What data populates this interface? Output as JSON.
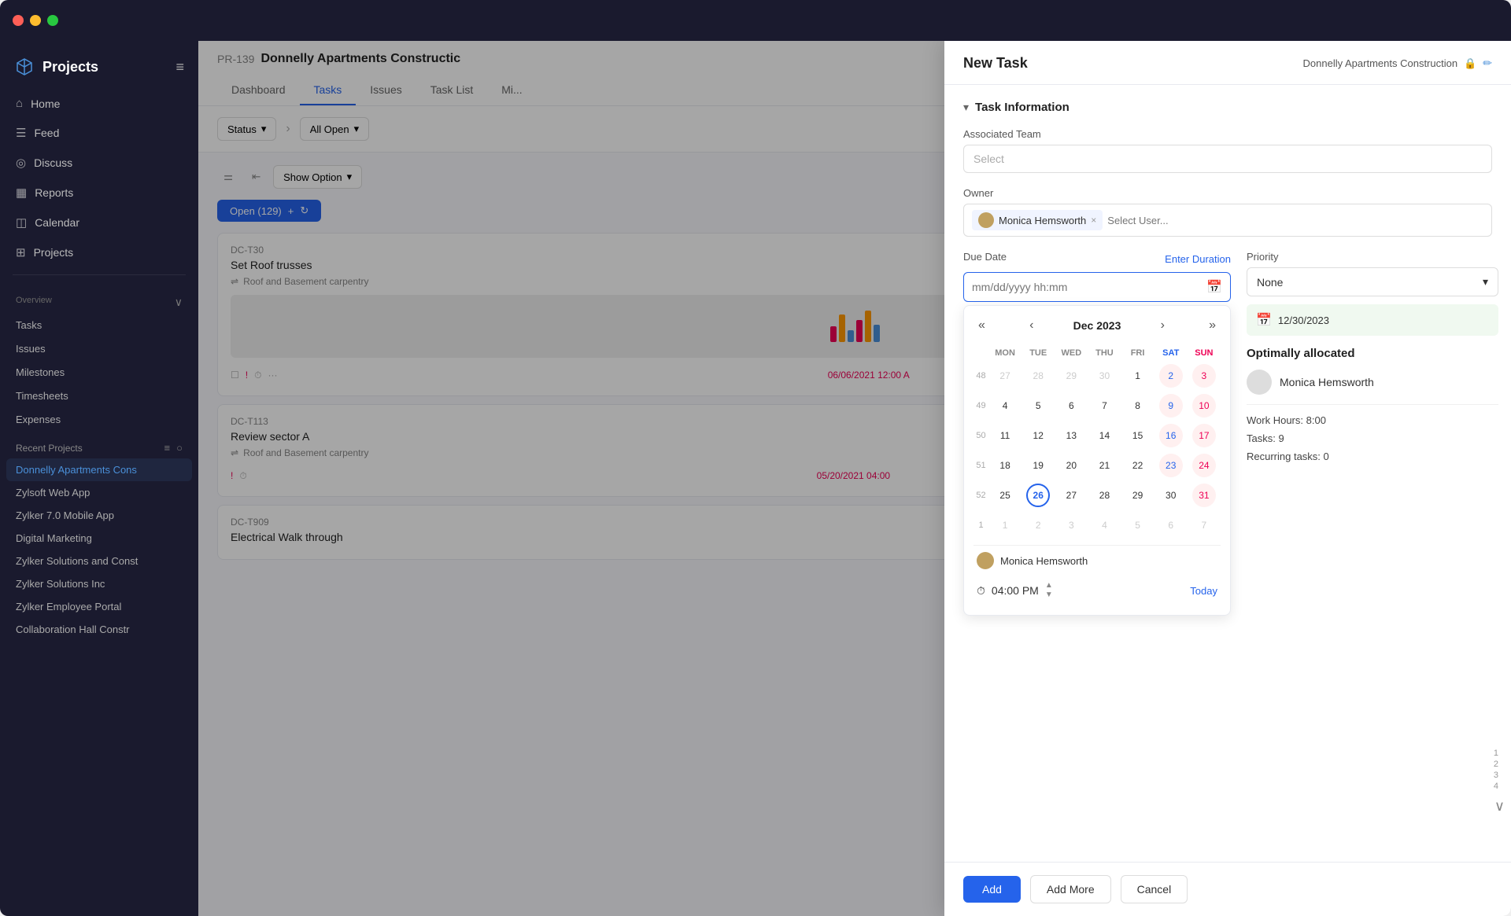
{
  "window": {
    "titlebar": {
      "dots": [
        "red",
        "yellow",
        "green"
      ]
    }
  },
  "sidebar": {
    "logo": "Projects",
    "nav_items": [
      {
        "id": "home",
        "label": "Home",
        "icon": "⌂"
      },
      {
        "id": "feed",
        "label": "Feed",
        "icon": "☰"
      },
      {
        "id": "discuss",
        "label": "Discuss",
        "icon": "◎"
      },
      {
        "id": "reports",
        "label": "Reports",
        "icon": "▦"
      },
      {
        "id": "calendar",
        "label": "Calendar",
        "icon": "◫"
      },
      {
        "id": "projects",
        "label": "Projects",
        "icon": "⊞"
      }
    ],
    "overview_label": "Overview",
    "sub_nav": [
      {
        "id": "tasks",
        "label": "Tasks"
      },
      {
        "id": "issues",
        "label": "Issues"
      },
      {
        "id": "milestones",
        "label": "Milestones"
      },
      {
        "id": "timesheets",
        "label": "Timesheets"
      },
      {
        "id": "expenses",
        "label": "Expenses"
      }
    ],
    "recent_projects_label": "Recent Projects",
    "projects": [
      {
        "id": "donnelly",
        "label": "Donnelly Apartments Cons",
        "active": true
      },
      {
        "id": "zylsoft",
        "label": "Zylsoft Web App"
      },
      {
        "id": "zylker70",
        "label": "Zylker 7.0 Mobile App"
      },
      {
        "id": "digital",
        "label": "Digital Marketing"
      },
      {
        "id": "zylker-solutions",
        "label": "Zylker Solutions and Const"
      },
      {
        "id": "zylker-inc",
        "label": "Zylker Solutions Inc"
      },
      {
        "id": "employee-portal",
        "label": "Zylker Employee Portal"
      },
      {
        "id": "collaboration",
        "label": "Collaboration Hall Constr"
      }
    ]
  },
  "project_header": {
    "id": "PR-139",
    "name": "Donnelly Apartments Constructic",
    "tabs": [
      "Dashboard",
      "Tasks",
      "Issues",
      "Task List",
      "Mi..."
    ]
  },
  "toolbar": {
    "status_label": "Status",
    "all_open_label": "All Open",
    "show_option_label": "Show Option"
  },
  "tasks": {
    "open_count": "Open (129)",
    "cards": [
      {
        "id": "DC-T30",
        "title": "Set Roof trusses",
        "subtitle": "Roof and Basement carpentry",
        "date": "06/06/2021 12:00 A",
        "has_thumb": true
      },
      {
        "id": "DC-T113",
        "title": "Review sector A",
        "subtitle": "Roof and Basement carpentry",
        "date": "05/20/2021 04:00",
        "has_thumb": false
      },
      {
        "id": "DC-T909",
        "title": "Electrical Walk through",
        "subtitle": "",
        "date": "",
        "has_thumb": false
      }
    ]
  },
  "modal": {
    "title": "New Task",
    "project_name": "Donnelly Apartments Construction",
    "sections": {
      "task_info": {
        "label": "Task Information",
        "associated_team_label": "Associated Team",
        "associated_team_placeholder": "Select",
        "owner_label": "Owner",
        "owner_name": "Monica Hemsworth",
        "owner_input_placeholder": "Select User...",
        "due_date_label": "Due Date",
        "enter_duration_label": "Enter Duration",
        "date_placeholder": "mm/dd/yyyy hh:mm",
        "priority_label": "Priority",
        "priority_value": "None"
      }
    },
    "calendar": {
      "month": "Dec 2023",
      "days_header": [
        "MON",
        "TUE",
        "WED",
        "THU",
        "FRI",
        "SAT",
        "SUN"
      ],
      "weeks": [
        {
          "week_num": "48",
          "days": [
            {
              "num": "27",
              "type": "other-month"
            },
            {
              "num": "28",
              "type": "other-month"
            },
            {
              "num": "29",
              "type": "other-month"
            },
            {
              "num": "30",
              "type": "other-month"
            },
            {
              "num": "1",
              "type": "normal"
            },
            {
              "num": "2",
              "type": "sat"
            },
            {
              "num": "3",
              "type": "sun"
            }
          ]
        },
        {
          "week_num": "49",
          "days": [
            {
              "num": "4",
              "type": "normal"
            },
            {
              "num": "5",
              "type": "normal"
            },
            {
              "num": "6",
              "type": "normal"
            },
            {
              "num": "7",
              "type": "normal"
            },
            {
              "num": "8",
              "type": "normal"
            },
            {
              "num": "9",
              "type": "sat"
            },
            {
              "num": "10",
              "type": "sun"
            }
          ]
        },
        {
          "week_num": "50",
          "days": [
            {
              "num": "11",
              "type": "normal"
            },
            {
              "num": "12",
              "type": "normal"
            },
            {
              "num": "13",
              "type": "normal"
            },
            {
              "num": "14",
              "type": "normal"
            },
            {
              "num": "15",
              "type": "normal"
            },
            {
              "num": "16",
              "type": "sat"
            },
            {
              "num": "17",
              "type": "sun"
            }
          ]
        },
        {
          "week_num": "51",
          "days": [
            {
              "num": "18",
              "type": "normal"
            },
            {
              "num": "19",
              "type": "normal"
            },
            {
              "num": "20",
              "type": "normal"
            },
            {
              "num": "21",
              "type": "normal"
            },
            {
              "num": "22",
              "type": "normal"
            },
            {
              "num": "23",
              "type": "sat"
            },
            {
              "num": "24",
              "type": "sun"
            }
          ]
        },
        {
          "week_num": "52",
          "days": [
            {
              "num": "25",
              "type": "normal"
            },
            {
              "num": "26",
              "type": "today"
            },
            {
              "num": "27",
              "type": "normal"
            },
            {
              "num": "28",
              "type": "normal"
            },
            {
              "num": "29",
              "type": "normal"
            },
            {
              "num": "30",
              "type": "normal"
            },
            {
              "num": "31",
              "type": "sun"
            }
          ]
        },
        {
          "week_num": "1",
          "days": [
            {
              "num": "1",
              "type": "other-month"
            },
            {
              "num": "2",
              "type": "other-month"
            },
            {
              "num": "3",
              "type": "other-month"
            },
            {
              "num": "4",
              "type": "other-month"
            },
            {
              "num": "5",
              "type": "other-month"
            },
            {
              "num": "6",
              "type": "other-month sat"
            },
            {
              "num": "7",
              "type": "other-month sun"
            }
          ]
        }
      ],
      "user_name": "Monica Hemsworth",
      "time": "04:00 PM",
      "today_label": "Today"
    },
    "date_suggestion": "12/30/2023",
    "optimally_allocated": {
      "title": "Optimally allocated",
      "user_name": "Monica Hemsworth",
      "work_hours_label": "Work Hours:",
      "work_hours_value": "8:00",
      "tasks_label": "Tasks:",
      "tasks_value": "9",
      "recurring_label": "Recurring tasks:",
      "recurring_value": "0"
    },
    "footer": {
      "add_label": "Add",
      "add_more_label": "Add More",
      "cancel_label": "Cancel"
    }
  }
}
